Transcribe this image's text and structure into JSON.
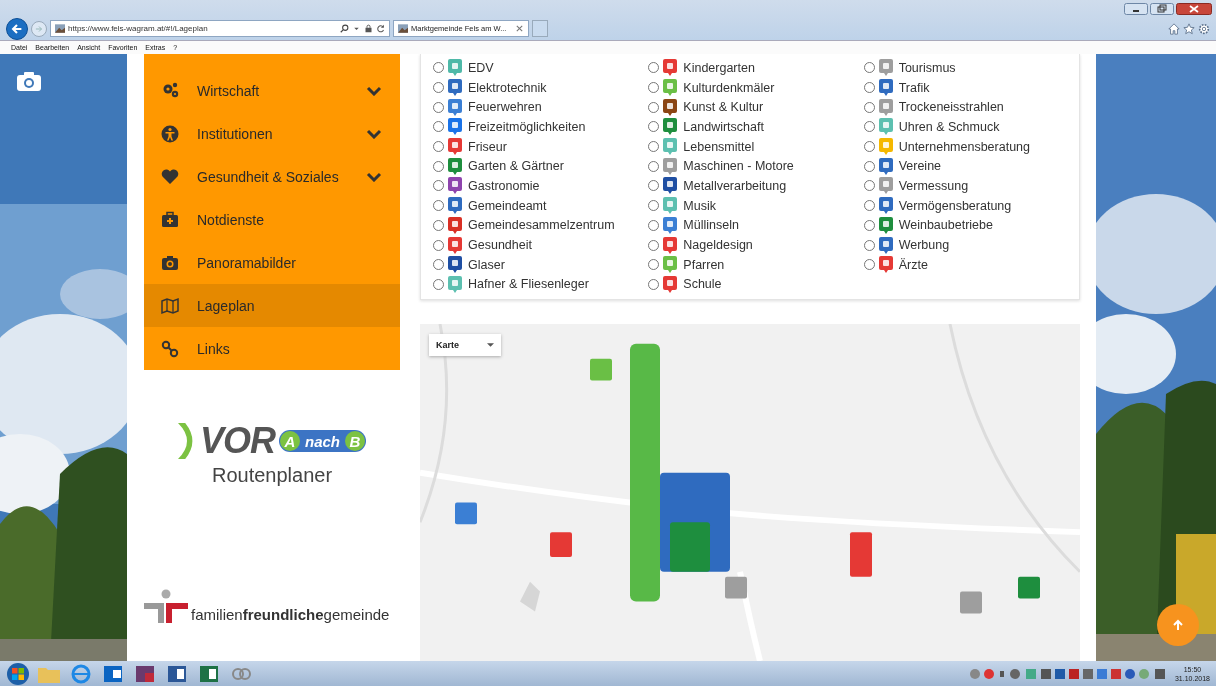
{
  "browser": {
    "url": "https://www.fels-wagram.at/#!/Lageplan",
    "tab_title": "Marktgemeinde Fels am W...",
    "menu": [
      "Datei",
      "Bearbeiten",
      "Ansicht",
      "Favoriten",
      "Extras",
      "?"
    ]
  },
  "sidebar": {
    "items": [
      {
        "label": "Wirtschaft",
        "has_submenu": true,
        "selected": false
      },
      {
        "label": "Institutionen",
        "has_submenu": true,
        "selected": false
      },
      {
        "label": "Gesundheit & Soziales",
        "has_submenu": true,
        "selected": false
      },
      {
        "label": "Notdienste",
        "has_submenu": false,
        "selected": false
      },
      {
        "label": "Panoramabilder",
        "has_submenu": false,
        "selected": false
      },
      {
        "label": "Lageplan",
        "has_submenu": false,
        "selected": true
      },
      {
        "label": "Links",
        "has_submenu": false,
        "selected": false
      }
    ]
  },
  "logos": {
    "vor": {
      "name": "VOR",
      "from": "A",
      "word": "nach",
      "to": "B",
      "caption": "Routenplaner"
    },
    "family": "familien**freundliche**gemeinde"
  },
  "categories": {
    "columns": [
      [
        {
          "label": "EDV",
          "color": "#4fb9a8",
          "selected": false
        },
        {
          "label": "Elektrotechnik",
          "color": "#2f6bbf",
          "selected": false
        },
        {
          "label": "Feuerwehren",
          "color": "#3b7fd4",
          "selected": false
        },
        {
          "label": "Freizeitmöglichkeiten",
          "color": "#1a73e8",
          "selected": false
        },
        {
          "label": "Friseur",
          "color": "#e53935",
          "selected": false
        },
        {
          "label": "Garten & Gärtner",
          "color": "#1e8e3e",
          "selected": false
        },
        {
          "label": "Gastronomie",
          "color": "#8e44ad",
          "selected": false
        },
        {
          "label": "Gemeindeamt",
          "color": "#2f6bbf",
          "selected": false
        },
        {
          "label": "Gemeindesammelzentrum",
          "color": "#d93025",
          "selected": false
        },
        {
          "label": "Gesundheit",
          "color": "#e53935",
          "selected": false
        },
        {
          "label": "Glaser",
          "color": "#1f4fa3",
          "selected": false
        },
        {
          "label": "Hafner & Fliesenleger",
          "color": "#5dc0b0",
          "selected": false
        }
      ],
      [
        {
          "label": "Kindergarten",
          "color": "#e53935",
          "selected": false
        },
        {
          "label": "Kulturdenkmäler",
          "color": "#6abf45",
          "selected": false
        },
        {
          "label": "Kunst & Kultur",
          "color": "#8b4513",
          "selected": false
        },
        {
          "label": "Landwirtschaft",
          "color": "#1e8e3e",
          "selected": false
        },
        {
          "label": "Lebensmittel",
          "color": "#5dc0b0",
          "selected": false
        },
        {
          "label": "Maschinen - Motore",
          "color": "#9e9e9e",
          "selected": false
        },
        {
          "label": "Metallverarbeitung",
          "color": "#1f4fa3",
          "selected": false
        },
        {
          "label": "Musik",
          "color": "#5dc0b0",
          "selected": false
        },
        {
          "label": "Müllinseln",
          "color": "#3b7fd4",
          "selected": false
        },
        {
          "label": "Nageldesign",
          "color": "#e53935",
          "selected": false
        },
        {
          "label": "Pfarren",
          "color": "#6abf45",
          "selected": false
        },
        {
          "label": "Schule",
          "color": "#e53935",
          "selected": false
        }
      ],
      [
        {
          "label": "Tourismus",
          "color": "#9e9e9e",
          "selected": false
        },
        {
          "label": "Trafik",
          "color": "#2f6bbf",
          "selected": false
        },
        {
          "label": "Trockeneisstrahlen",
          "color": "#9e9e9e",
          "selected": false
        },
        {
          "label": "Uhren & Schmuck",
          "color": "#5dc0b0",
          "selected": false
        },
        {
          "label": "Unternehmensberatung",
          "color": "#f5b800",
          "selected": false
        },
        {
          "label": "Vereine",
          "color": "#2f6bbf",
          "selected": false
        },
        {
          "label": "Vermessung",
          "color": "#9e9e9e",
          "selected": false
        },
        {
          "label": "Vermögensberatung",
          "color": "#2f6bbf",
          "selected": false
        },
        {
          "label": "Weinbaubetriebe",
          "color": "#1e8e3e",
          "selected": false
        },
        {
          "label": "Werbung",
          "color": "#2f6bbf",
          "selected": false
        },
        {
          "label": "Ärzte",
          "color": "#e53935",
          "selected": false
        }
      ]
    ]
  },
  "map": {
    "map_type": "Karte"
  },
  "taskbar": {
    "time": "15:50",
    "date": "31.10.2018"
  }
}
